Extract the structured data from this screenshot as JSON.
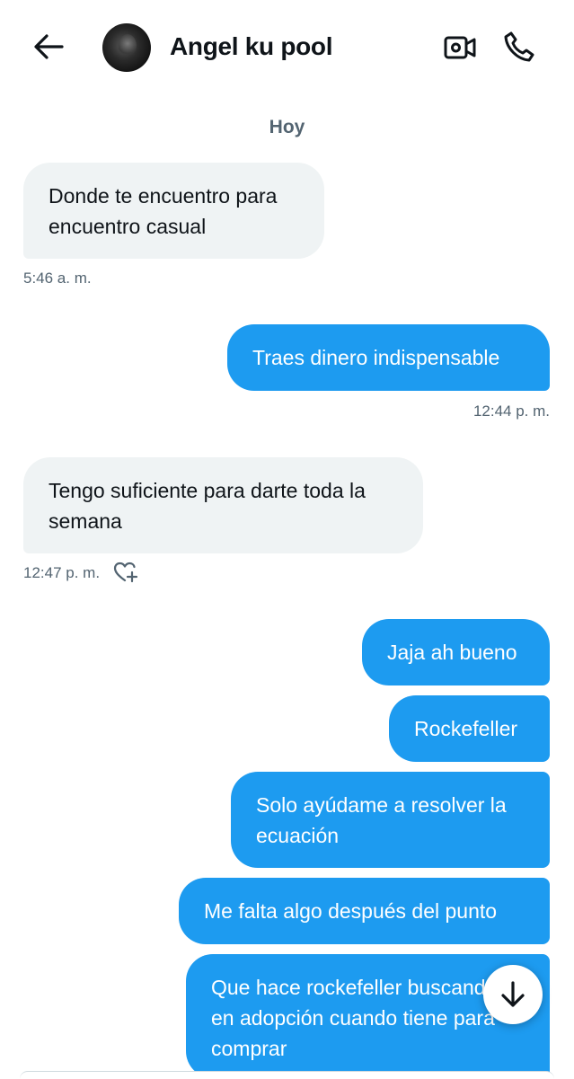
{
  "header": {
    "contact_name": "Angel ku pool",
    "icons": {
      "back": "arrow-left-icon",
      "video": "video-camera-icon",
      "call": "phone-icon"
    }
  },
  "day_separator": "Hoy",
  "messages": [
    {
      "direction": "in",
      "text": "Donde te encuentro para encuentro casual",
      "time": "5:46 a. m."
    },
    {
      "direction": "out",
      "text": "Traes dinero indispensable",
      "time": "12:44 p. m."
    },
    {
      "direction": "in",
      "text": "Tengo suficiente para darte toda la semana",
      "time": "12:47 p. m.",
      "react_icon": "heart-plus-icon"
    },
    {
      "direction": "out",
      "text": "Jaja ah bueno"
    },
    {
      "direction": "out",
      "text": "Rockefeller"
    },
    {
      "direction": "out",
      "text": "Solo ayúdame a resolver la ecuación"
    },
    {
      "direction": "out",
      "text": "Me falta algo después del punto"
    },
    {
      "direction": "out",
      "text": "Que hace rockefeller buscando en adopción cuando tiene para comprar"
    }
  ],
  "scroll_down_icon": "arrow-down-icon",
  "colors": {
    "outgoing_bubble": "#1d9bf0",
    "incoming_bubble": "#eff3f4",
    "secondary_text": "#536471"
  }
}
